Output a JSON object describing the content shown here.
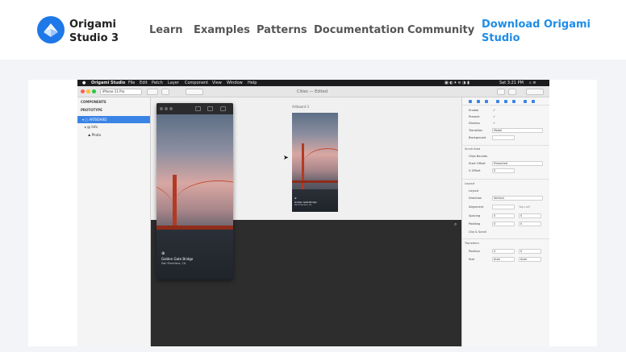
{
  "brand": {
    "line1": "Origami",
    "line2": "Studio 3",
    "logo_icon": "origami-logo-icon",
    "logo_color": "#1e78e8"
  },
  "nav": {
    "links": [
      {
        "label": "Learn"
      },
      {
        "label": "Examples"
      },
      {
        "label": "Patterns"
      },
      {
        "label": "Documentation"
      },
      {
        "label": "Community"
      }
    ],
    "cta": {
      "line1": "Download Origami",
      "line2": "Studio",
      "color": "#1e8de8"
    }
  },
  "app": {
    "menubar": {
      "items": [
        "Origami Studio",
        "File",
        "Edit",
        "Patch",
        "Layer",
        "Component",
        "View",
        "Window",
        "Help"
      ],
      "clock": "Sat 3:21 PM"
    },
    "toolbar": {
      "device": "iPhone 11 Pro",
      "doc_title": "Cities — Edited"
    },
    "sidebar": {
      "section_components": "COMPONENTS",
      "section_prototype": "PROTOTYPE",
      "layers": [
        {
          "label": "ARTBOARD"
        },
        {
          "label": "Info"
        },
        {
          "label": "Photo"
        }
      ]
    },
    "canvas": {
      "artboard_label": "Artboard 1"
    },
    "viewer": {
      "caption_title": "Golden Gate Bridge",
      "caption_sub": "San Francisco, CA"
    },
    "artboard_caption": {
      "title": "Golden Gate Bridge",
      "sub": "San Francisco, CA"
    },
    "inspector": {
      "rows": [
        {
          "label": "Enable",
          "value": "✓"
        },
        {
          "label": "Present",
          "value": "✓"
        },
        {
          "label": "Dismiss",
          "value": "✓"
        },
        {
          "label": "Transition",
          "value": "Modal"
        },
        {
          "label": "Background",
          "value": ""
        }
      ],
      "section_scroll": "Scroll Area",
      "scroll_rows": [
        {
          "label": "Clips Bounds",
          "value": ""
        },
        {
          "label": "Start Offset",
          "value": "Presented"
        },
        {
          "label": "X Offset",
          "value": "0"
        }
      ],
      "section_layout": "Layout",
      "layout_rows": [
        {
          "label": "Layout",
          "value": ""
        },
        {
          "label": "Direction",
          "value": "Vertical"
        },
        {
          "label": "Alignment",
          "value": "Top Left"
        },
        {
          "label": "Spacing",
          "value": "0"
        },
        {
          "label": "Padding",
          "value": "0"
        },
        {
          "label": "Clip & Scroll",
          "value": ""
        }
      ],
      "section_transform": "Transform",
      "transform_rows": [
        {
          "label": "Position",
          "value": "0"
        },
        {
          "label": "Size",
          "value": "Auto"
        }
      ]
    }
  }
}
